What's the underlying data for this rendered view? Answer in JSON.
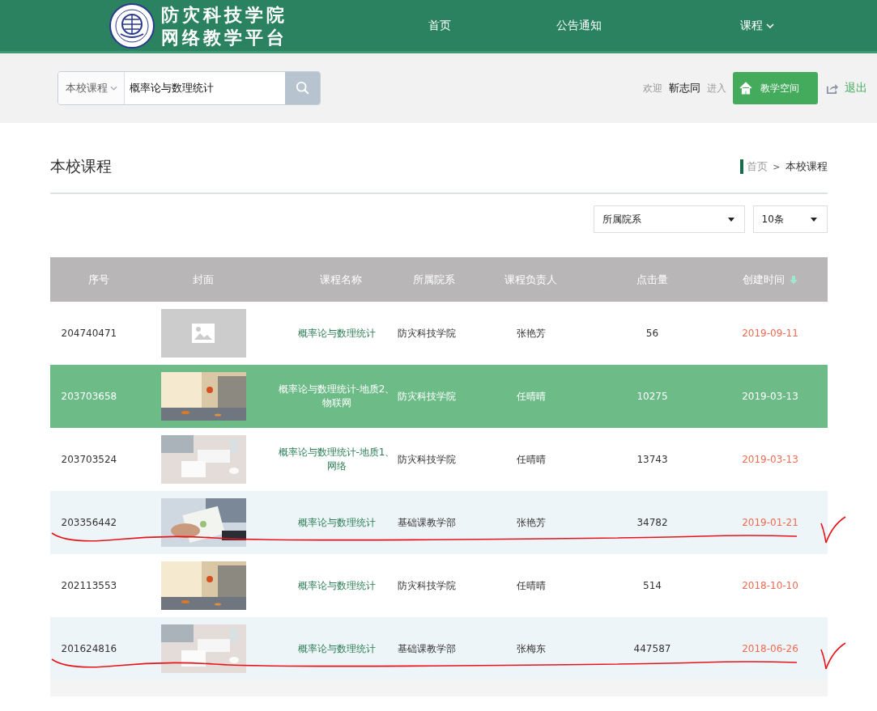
{
  "header": {
    "title_lines": [
      "防灾科技学院",
      "网络教学平台"
    ],
    "nav": [
      {
        "label": "首页",
        "dropdown": false
      },
      {
        "label": "公告通知",
        "dropdown": false
      },
      {
        "label": "课程",
        "dropdown": true
      }
    ]
  },
  "search": {
    "scope": "本校课程",
    "value": "概率论与数理统计"
  },
  "user": {
    "welcome": "欢迎",
    "name": "靳志同",
    "enter": "进入",
    "space_button": "教学空间",
    "logout": "退出"
  },
  "page_title": "本校课程",
  "breadcrumb": [
    "首页",
    ">",
    "本校课程"
  ],
  "filters": [
    {
      "value": "所属院系"
    },
    {
      "value": "10条"
    }
  ],
  "table": {
    "columns": [
      {
        "label": "序号",
        "sorted": false
      },
      {
        "label": "封面",
        "sorted": false
      },
      {
        "label": "课程名称",
        "sorted": false
      },
      {
        "label": "所属院系",
        "sorted": false
      },
      {
        "label": "课程负责人",
        "sorted": false
      },
      {
        "label": "点击量",
        "sorted": false
      },
      {
        "label": "创建时间",
        "sorted": true
      }
    ],
    "rows": [
      {
        "id": "204740471",
        "has_cover": false,
        "name": "概率论与数理统计",
        "dept": "防灾科技学院",
        "owner": "张艳芳",
        "clicks": "56",
        "date": "2019-09-11",
        "selected": false,
        "marked": false
      },
      {
        "id": "203703658",
        "has_cover": true,
        "name": "概率论与数理统计-地质2、物联网",
        "dept": "防灾科技学院",
        "owner": "任晴晴",
        "clicks": "10275",
        "date": "2019-03-13",
        "selected": true,
        "marked": false
      },
      {
        "id": "203703524",
        "has_cover": true,
        "name": "概率论与数理统计-地质1、网络",
        "dept": "防灾科技学院",
        "owner": "任晴晴",
        "clicks": "13743",
        "date": "2019-03-13",
        "selected": false,
        "marked": false
      },
      {
        "id": "203356442",
        "has_cover": true,
        "name": "概率论与数理统计",
        "dept": "基础课教学部",
        "owner": "张艳芳",
        "clicks": "34782",
        "date": "2019-01-21",
        "selected": false,
        "marked": true
      },
      {
        "id": "202113553",
        "has_cover": true,
        "name": "概率论与数理统计",
        "dept": "防灾科技学院",
        "owner": "任晴晴",
        "clicks": "514",
        "date": "2018-10-10",
        "selected": false,
        "marked": false
      },
      {
        "id": "201624816",
        "has_cover": true,
        "name": "概率论与数理统计",
        "dept": "基础课教学部",
        "owner": "张梅东",
        "clicks": "447587",
        "date": "2018-06-26",
        "selected": false,
        "marked": true
      }
    ]
  }
}
